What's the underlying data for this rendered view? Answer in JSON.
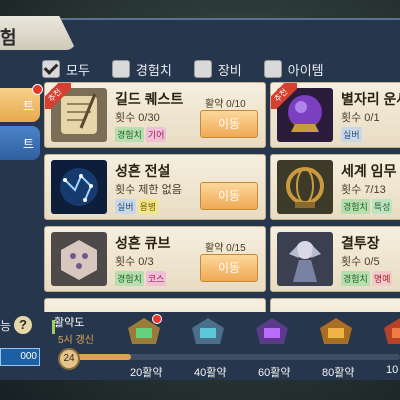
{
  "window": {
    "title": "험"
  },
  "filters": [
    {
      "label": "모두",
      "checked": true
    },
    {
      "label": "경험치",
      "checked": false
    },
    {
      "label": "장비",
      "checked": false
    },
    {
      "label": "아이템",
      "checked": false
    }
  ],
  "side_tabs": [
    {
      "label": "트",
      "active": true
    },
    {
      "label": "트",
      "active": false
    }
  ],
  "quests": [
    {
      "name": "길드 퀘스트",
      "count": "횟수 0/30",
      "activity": "활약 0/10",
      "button": "이동",
      "tags": [
        {
          "text": "경험치",
          "type": "xp"
        },
        {
          "text": "기어",
          "type": "gi"
        }
      ],
      "recommended": true
    },
    {
      "name": "별자리 운세",
      "count": "횟수 0/1",
      "activity": "",
      "button": "",
      "tags": [
        {
          "text": "실버",
          "type": "silver"
        }
      ],
      "recommended": true
    },
    {
      "name": "성흔 전설",
      "count": "횟수 제한 없음",
      "activity": "",
      "button": "이동",
      "tags": [
        {
          "text": "실버",
          "type": "silver"
        },
        {
          "text": "용병",
          "type": "brave"
        }
      ],
      "recommended": false
    },
    {
      "name": "세계 임무",
      "count": "횟수 7/13",
      "activity": "",
      "button": "",
      "tags": [
        {
          "text": "경험치",
          "type": "xp"
        },
        {
          "text": "특성",
          "type": "special"
        }
      ],
      "recommended": false
    },
    {
      "name": "성흔 큐브",
      "count": "횟수 0/3",
      "activity": "활약 0/15",
      "button": "이동",
      "tags": [
        {
          "text": "경험치",
          "type": "xp"
        },
        {
          "text": "코스",
          "type": "gi"
        }
      ],
      "recommended": false
    },
    {
      "name": "결투장",
      "count": "횟수 0/5",
      "activity": "",
      "button": "",
      "tags": [
        {
          "text": "경험치",
          "type": "xp"
        },
        {
          "text": "명예",
          "type": "fame"
        }
      ],
      "recommended": false
    }
  ],
  "progress": {
    "label": "활약도",
    "refresh": "5시 갱신",
    "current": "24",
    "fill_fraction": 0.2,
    "milestones": [
      "20활약",
      "40활약",
      "60활약",
      "80활약",
      "10"
    ]
  },
  "left_panel": {
    "help_label": "능",
    "value": "000"
  },
  "colors": {
    "accent": "#e0a24a",
    "window": "#25364d"
  }
}
